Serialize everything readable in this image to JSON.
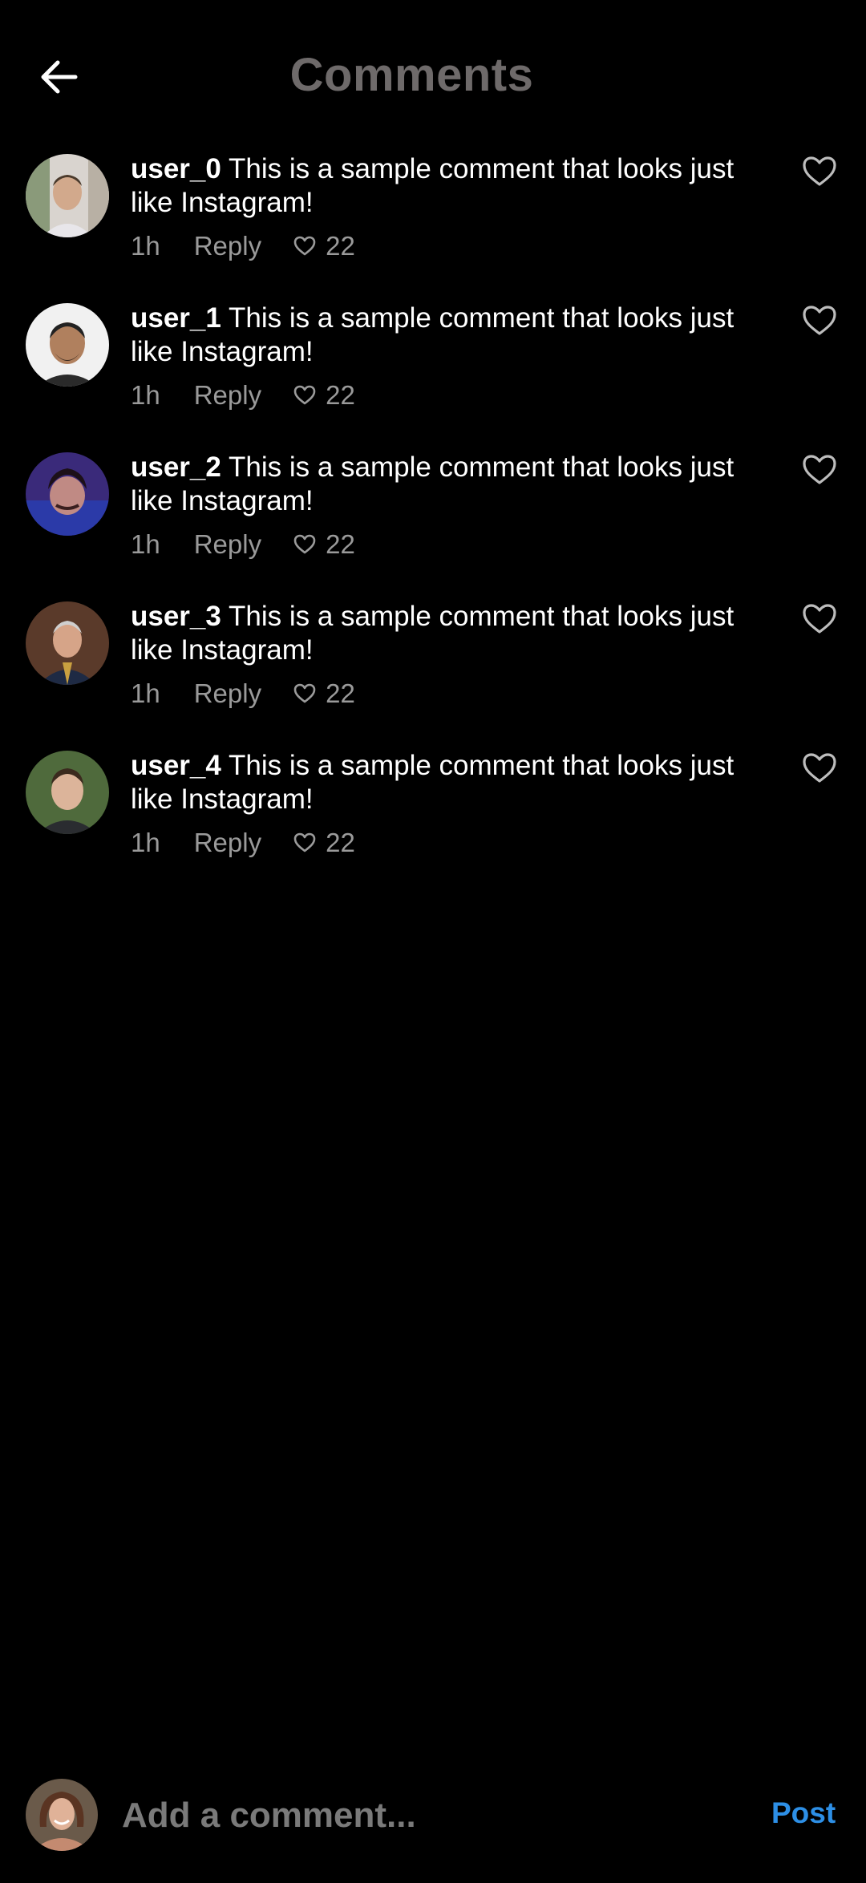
{
  "header": {
    "back_icon": "arrow-left-icon",
    "title": "Comments"
  },
  "comments": [
    {
      "username": "user_0",
      "text": "This is a sample comment that looks just like Instagram!",
      "time": "1h",
      "reply_label": "Reply",
      "like_count": "22",
      "avatar": "avatar-user-0"
    },
    {
      "username": "user_1",
      "text": "This is a sample comment that looks just like Instagram!",
      "time": "1h",
      "reply_label": "Reply",
      "like_count": "22",
      "avatar": "avatar-user-1"
    },
    {
      "username": "user_2",
      "text": "This is a sample comment that looks just like Instagram!",
      "time": "1h",
      "reply_label": "Reply",
      "like_count": "22",
      "avatar": "avatar-user-2"
    },
    {
      "username": "user_3",
      "text": "This is a sample comment that looks just like Instagram!",
      "time": "1h",
      "reply_label": "Reply",
      "like_count": "22",
      "avatar": "avatar-user-3"
    },
    {
      "username": "user_4",
      "text": "This is a sample comment that looks just like Instagram!",
      "time": "1h",
      "reply_label": "Reply",
      "like_count": "22",
      "avatar": "avatar-user-4"
    }
  ],
  "composer": {
    "placeholder": "Add a comment...",
    "post_label": "Post"
  },
  "colors": {
    "background": "#000000",
    "title": "#6e6a6a",
    "meta": "#9a9a9a",
    "accent": "#2d8fe6"
  }
}
